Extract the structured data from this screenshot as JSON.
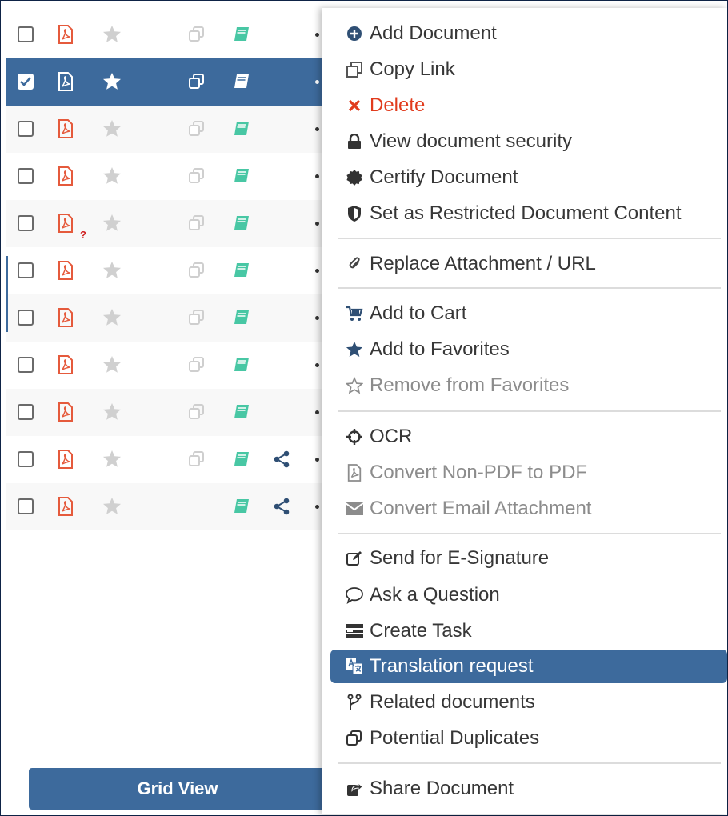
{
  "colors": {
    "accent": "#3d6a9c",
    "pdf_red": "#e55a3c",
    "book_teal": "#48c7a4",
    "star_gray": "#d0d0d0",
    "danger": "#e13b1d"
  },
  "rows": [
    {
      "checked": false,
      "selected": false,
      "icons": [
        "checkbox",
        "pdf-icon",
        "star-icon",
        "duplicate-icon",
        "book-icon"
      ]
    },
    {
      "checked": true,
      "selected": true,
      "icons": [
        "checkbox",
        "pdf-icon",
        "star-icon",
        "duplicate-icon",
        "book-icon"
      ]
    },
    {
      "checked": false,
      "selected": false
    },
    {
      "checked": false,
      "selected": false
    },
    {
      "checked": false,
      "selected": false,
      "has_question_mark": true
    },
    {
      "checked": false,
      "selected": false
    },
    {
      "checked": false,
      "selected": false
    },
    {
      "checked": false,
      "selected": false
    },
    {
      "checked": false,
      "selected": false
    },
    {
      "checked": false,
      "selected": false,
      "shared": true
    },
    {
      "checked": false,
      "selected": false,
      "shared": true,
      "no_duplicate": true
    }
  ],
  "question_mark": "?",
  "grid_view_button": "Grid View",
  "menu": {
    "add_document": "Add Document",
    "copy_link": "Copy Link",
    "delete": "Delete",
    "view_security": "View document security",
    "certify": "Certify Document",
    "restricted": "Set as Restricted Document Content",
    "replace_attachment": "Replace Attachment / URL",
    "add_to_cart": "Add to Cart",
    "add_to_favorites": "Add to Favorites",
    "remove_from_favorites": "Remove from Favorites",
    "ocr": "OCR",
    "convert_non_pdf": "Convert Non-PDF to PDF",
    "convert_email": "Convert Email Attachment",
    "send_esignature": "Send for E-Signature",
    "ask_question": "Ask a Question",
    "create_task": "Create Task",
    "translation_request": "Translation request",
    "related_documents": "Related documents",
    "potential_duplicates": "Potential Duplicates",
    "share_document": "Share Document"
  }
}
